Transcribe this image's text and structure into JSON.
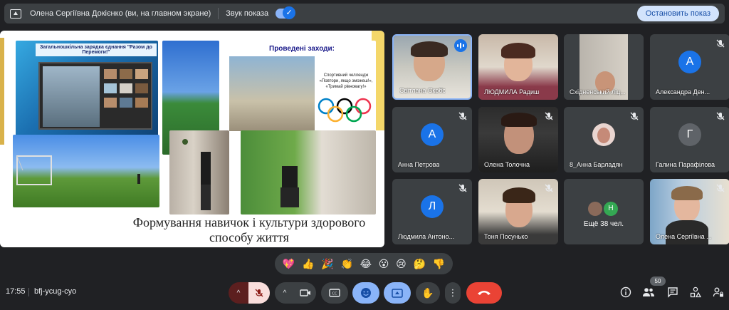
{
  "topbar": {
    "presenter": "Олена Сергіївна Докієнко (ви, на главном экране)",
    "sound_label": "Звук показа",
    "stop_button": "Остановить показ"
  },
  "slide": {
    "panel_title": "Загальношкільна зарядка єднання \"Разом до Перемоги!\"",
    "events_title": "Проведені заходи:",
    "events_text": "Спортивний челлендж «Повтори, якщо зможеш!», «Тримай рівновагу!»",
    "caption": "Формування навичок і культури здорового способу життя"
  },
  "participants": [
    {
      "name": "Світлана Скрбс",
      "muted": false,
      "speaking": true
    },
    {
      "name": "ЛЮДМИЛА Радиш",
      "muted": false
    },
    {
      "name": "Східненський ліц...",
      "muted": false
    },
    {
      "name": "Александра Ден...",
      "initial": "А",
      "muted": true
    },
    {
      "name": "Анна Петрова",
      "initial": "А",
      "muted": true
    },
    {
      "name": "Олена Толочна",
      "muted": true
    },
    {
      "name": "8_Анна Барладян",
      "muted": true
    },
    {
      "name": "Галина Парафілова",
      "initial": "Г",
      "muted": true
    },
    {
      "name": "Людмила Антоно...",
      "initial": "Л",
      "muted": true
    },
    {
      "name": "Тоня Посунько",
      "muted": true
    },
    {
      "name": "Ещё 38 чел.",
      "initial": "Н",
      "muted": false
    },
    {
      "name": "Олена Сергіївна ...",
      "muted": true
    }
  ],
  "reactions": [
    "💖",
    "👍",
    "🎉",
    "👏",
    "😂",
    "😮",
    "😢",
    "🤔",
    "👎"
  ],
  "bottom": {
    "time": "17:55",
    "meeting_code": "bfj-ycug-cyo",
    "participants_count": "50"
  },
  "colors": {
    "accent_blue": "#8ab4f8",
    "end_call_red": "#ea4335",
    "background": "#202124",
    "tile": "#3c4043"
  }
}
